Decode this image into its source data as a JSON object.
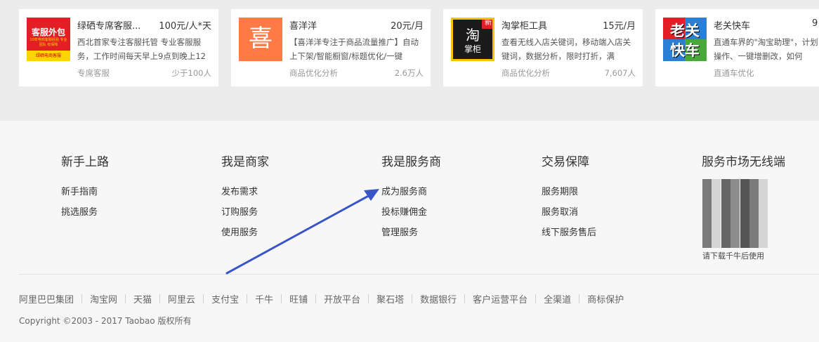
{
  "cards": [
    {
      "name": "绿硒专席客服...",
      "price": "100元/人*天",
      "description": "西北首家专注客服托管 专业客服服务，工作时间每天早上9点到晚上12",
      "category": "专席客服",
      "users": "少于100人",
      "logo": {
        "line1": "客服外包",
        "line2": "10年电商客服经验 专业团队 有保障",
        "line3": "绿硒电商客服"
      }
    },
    {
      "name": "喜洋洋",
      "price": "20元/月",
      "description": "【喜洋洋专注于商品流量推广】自动上下架/智能橱窗/标题优化/一键",
      "category": "商品优化分析",
      "users": "2.6万人",
      "logo": {
        "line1": "喜"
      }
    },
    {
      "name": "淘掌柜工具",
      "price": "15元/月",
      "description": "查看无线入店关键词，移动端入店关键词，数据分析，限时打折，满",
      "category": "商品优化分析",
      "users": "7,607人",
      "logo": {
        "line1": "淘",
        "line2": "掌柜",
        "tag": "新"
      }
    },
    {
      "name": "老关快车",
      "price": "9",
      "description": "直通车界的\"淘宝助理\"，计划操作、一键增删改，如何",
      "category": "直通车优化",
      "users": "",
      "logo": {
        "line1": "老关",
        "line2": "快车"
      }
    }
  ],
  "footer": {
    "columns": [
      {
        "title": "新手上路",
        "links": [
          "新手指南",
          "挑选服务"
        ]
      },
      {
        "title": "我是商家",
        "links": [
          "发布需求",
          "订购服务",
          "使用服务"
        ]
      },
      {
        "title": "我是服务商",
        "links": [
          "成为服务商",
          "投标赚佣金",
          "管理服务"
        ]
      },
      {
        "title": "交易保障",
        "links": [
          "服务期限",
          "服务取消",
          "线下服务售后"
        ]
      },
      {
        "title": "服务市场无线端",
        "links": []
      }
    ],
    "qr_caption": "请下载千牛后使用",
    "bottom_links": [
      "阿里巴巴集团",
      "淘宝网",
      "天猫",
      "阿里云",
      "支付宝",
      "千牛",
      "旺铺",
      "开放平台",
      "聚石塔",
      "数据银行",
      "客户运营平台",
      "全渠道",
      "商标保护"
    ],
    "copyright": "Copyright ©2003 - 2017 Taobao 版权所有"
  },
  "colors": {
    "arrow": "#3a55c8"
  }
}
